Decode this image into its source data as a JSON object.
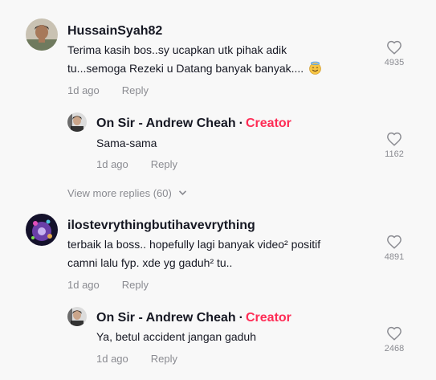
{
  "comments": [
    {
      "username": "HussainSyah82",
      "lines": [
        "Terima kasih bos..sy ucapkan utk pihak adik",
        "tu...semoga Rezeki u Datang banyak banyak...."
      ],
      "emoji_icon": "smiling-face-with-halo-icon",
      "time": "1d ago",
      "reply_label": "Reply",
      "likes": "4935",
      "replies": [
        {
          "username": "On Sir - Andrew Cheah",
          "creator_dot": "·",
          "creator_label": "Creator",
          "text": "Sama-sama",
          "time": "1d ago",
          "reply_label": "Reply",
          "likes": "1162"
        }
      ],
      "view_more": "View more replies (60)"
    },
    {
      "username": "ilostevrythingbutihavevrything",
      "lines": [
        "terbaik la boss.. hopefully lagi banyak video² positif",
        "camni lalu fyp. xde yg gaduh² tu.."
      ],
      "time": "1d ago",
      "reply_label": "Reply",
      "likes": "4891",
      "replies": [
        {
          "username": "On Sir - Andrew Cheah",
          "creator_dot": "·",
          "creator_label": "Creator",
          "text": "Ya, betul accident jangan gaduh",
          "time": "1d ago",
          "reply_label": "Reply",
          "likes": "2468"
        }
      ]
    }
  ],
  "colors": {
    "creator": "#fe2c55",
    "muted": "#8a8b91",
    "text": "#161823",
    "background": "#f8f8f8"
  }
}
